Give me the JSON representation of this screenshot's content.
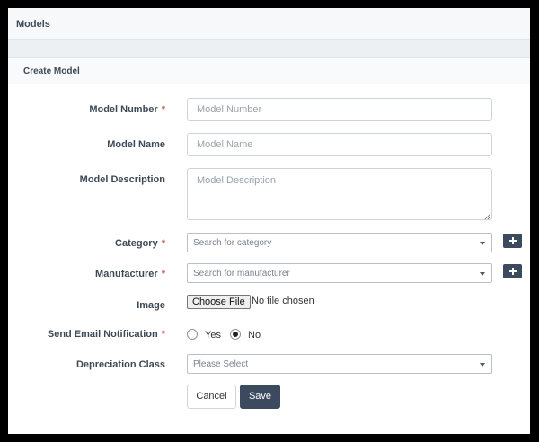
{
  "header": {
    "title": "Models"
  },
  "card": {
    "title": "Create Model"
  },
  "form": {
    "model_number": {
      "label": "Model Number",
      "required": "*",
      "placeholder": "Model Number",
      "value": ""
    },
    "model_name": {
      "label": "Model Name",
      "placeholder": "Model Name",
      "value": ""
    },
    "model_description": {
      "label": "Model Description",
      "placeholder": "Model Description",
      "value": ""
    },
    "category": {
      "label": "Category",
      "required": "*",
      "placeholder": "Search for category"
    },
    "manufacturer": {
      "label": "Manufacturer",
      "required": "*",
      "placeholder": "Search for manufacturer"
    },
    "image": {
      "label": "Image",
      "button_label": "Choose File",
      "status": "No file chosen"
    },
    "send_email": {
      "label": "Send Email Notification",
      "required": "*",
      "options": [
        {
          "label": "Yes",
          "checked": false
        },
        {
          "label": "No",
          "checked": true
        }
      ]
    },
    "depreciation": {
      "label": "Depreciation Class",
      "placeholder": "Please Select"
    }
  },
  "actions": {
    "cancel_label": "Cancel",
    "save_label": "Save"
  },
  "colors": {
    "primary": "#3b4a5e",
    "required": "#d9534f",
    "text": "#3c4a57"
  },
  "icons": {
    "add": "plus-icon",
    "dropdown": "caret-down-icon"
  }
}
